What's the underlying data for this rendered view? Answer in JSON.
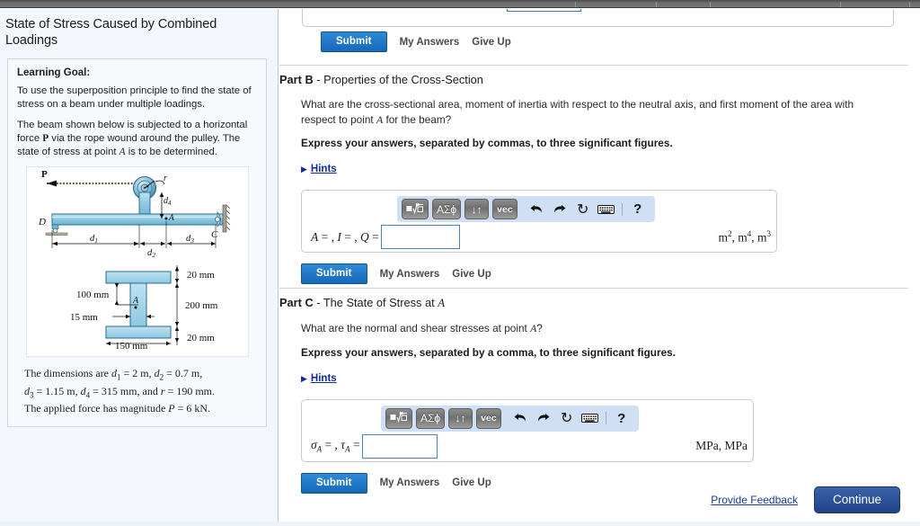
{
  "left": {
    "title": "State of Stress Caused by Combined Loadings",
    "goal_heading": "Learning Goal:",
    "goal_p1": "To use the superposition principle to find the state of stress on a beam under multiple loadings.",
    "goal_p2_a": "The beam shown below is subjected to a horizontal force ",
    "goal_p2_P": "P",
    "goal_p2_b": " via the rope wound around the pulley. The state of stress at point ",
    "goal_p2_A": "A",
    "goal_p2_c": " is to be determined.",
    "figure": {
      "label_P": "P",
      "label_r": "r",
      "label_D": "D",
      "label_C": "C",
      "label_A_beam": "A",
      "label_d1": "d",
      "label_d1_sub": "1",
      "label_d2": "d",
      "label_d2_sub": "2",
      "label_d3": "d",
      "label_d3_sub": "3",
      "label_d4": "d",
      "label_d4_sub": "4",
      "label_A_section": "A",
      "dim_top_flange": "20 mm",
      "dim_web_height_partial": "100 mm",
      "dim_web_total": "200 mm",
      "dim_web_thickness": "15 mm",
      "dim_bottom_flange": "20 mm",
      "dim_width": "150 mm",
      "beam_fill": "#9fd0e8",
      "beam_stroke": "#2a6b86"
    },
    "dimensions_line1": "The dimensions are d₁ = 2 m, d₂ = 0.7 m,",
    "dimensions_line2": "d₃ = 1.15 m, d₄ = 315 mm, and r = 190 mm.",
    "dimensions_line3": "The applied force has magnitude P = 6 kN.",
    "dims": {
      "intro": "The dimensions are ",
      "d1": "d",
      "d1s": "1",
      "d1v": " = 2 m, ",
      "d2": "d",
      "d2s": "2",
      "d2v": " = 0.7 m,",
      "d3": "d",
      "d3s": "3",
      "d3v": " = 1.15 m, ",
      "d4": "d",
      "d4s": "4",
      "d4v": " = 315 mm, and ",
      "r": "r",
      "rv": " = 190 mm.",
      "force_intro": "The applied force has magnitude ",
      "P": "P",
      "Pv": " = 6 kN."
    }
  },
  "top_cutoff": {
    "submit_label": "Submit",
    "my_answers_label": "My Answers",
    "give_up_label": "Give Up"
  },
  "part_b": {
    "part_label": "Part B",
    "dash": " - ",
    "part_name": "Properties of the Cross-Section",
    "question_a": "What are the cross-sectional area, moment of inertia with respect to the neutral axis, and first moment of the area with respect to point ",
    "question_var": "A",
    "question_b": " for the beam?",
    "instruction": "Express your answers, separated by commas, to three significant figures.",
    "hints_label": "Hints",
    "answer_label_a": "A",
    "answer_eq1": " = , ",
    "answer_label_i": "I",
    "answer_eq2": " = , ",
    "answer_label_q": "Q",
    "answer_eq3": " = ",
    "answer_value": "",
    "units_m": "m",
    "units_sup1": "2",
    "units_sep1": ", m",
    "units_sup2": "4",
    "units_sep2": ", m",
    "units_sup3": "3",
    "submit_label": "Submit",
    "my_answers_label": "My Answers",
    "give_up_label": "Give Up",
    "toolbar": {
      "btn_sqrt": "√",
      "btn_greek": "ΑΣϕ",
      "btn_updown": "↓↑",
      "btn_vec": "vec",
      "btn_undo": "undo-arrow",
      "btn_redo": "redo-arrow",
      "btn_reset": "↻",
      "btn_keyboard": "keyboard",
      "btn_help": "?"
    }
  },
  "part_c": {
    "part_label": "Part C",
    "dash": " - ",
    "part_name_a": "The State of Stress at ",
    "part_name_var": "A",
    "question_a": "What are the normal and shear stresses at point ",
    "question_var": "A",
    "question_b": "?",
    "instruction": "Express your answers, separated by a comma, to three significant figures.",
    "hints_label": "Hints",
    "answer_sigma": "σ",
    "answer_sigma_sub": "A",
    "answer_eq1": " = , ",
    "answer_tau": "τ",
    "answer_tau_sub": "A",
    "answer_eq2": " = ",
    "answer_value": "",
    "units": "MPa, MPa",
    "submit_label": "Submit",
    "my_answers_label": "My Answers",
    "give_up_label": "Give Up",
    "toolbar": {
      "btn_sqrt": "√",
      "btn_greek": "ΑΣϕ",
      "btn_updown": "↓↑",
      "btn_vec": "vec",
      "btn_reset": "↻",
      "btn_help": "?"
    }
  },
  "footer": {
    "feedback_label": "Provide Feedback",
    "continue_label": "Continue"
  },
  "colors": {
    "accent_blue": "#1a73c4",
    "continue_blue": "#2b4f95",
    "link_blue": "#11299c",
    "panel_bg": "#f3f7fc"
  }
}
